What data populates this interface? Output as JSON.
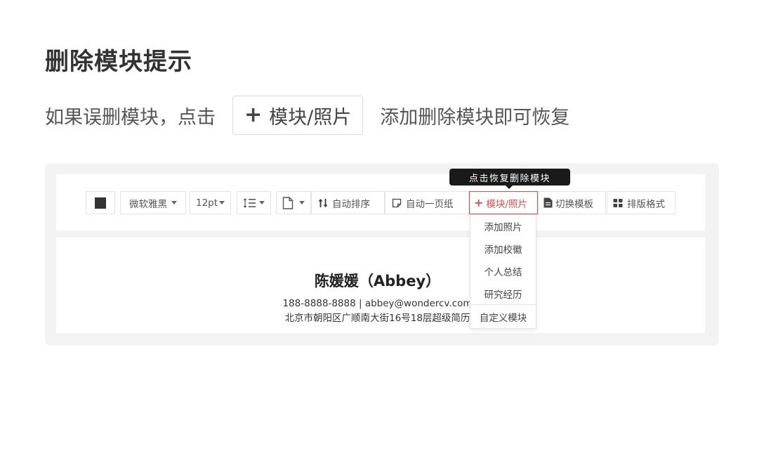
{
  "heading": "删除模块提示",
  "hint": {
    "before": "如果误删模块，点击",
    "button_plus": "+",
    "button_label": "模块/照片",
    "after": "添加删除模块即可恢复"
  },
  "toolbar": {
    "font": "微软雅黑",
    "font_size": "12pt",
    "sort_label": "自动排序",
    "onepage_label": "自动一页纸",
    "add_plus": "+",
    "add_label": "模块/照片",
    "template_label": "切换模板",
    "format_label": "排版格式"
  },
  "tooltip": "点击恢复删除模块",
  "dropdown": {
    "items": [
      "添加照片",
      "添加校徽",
      "个人总结",
      "研究经历",
      "自定义模块"
    ]
  },
  "resume": {
    "name": "陈媛媛（Abbey）",
    "contact": "188-8888-8888 | abbey@wondercv.com",
    "address": "北京市朝阳区广顺南大街16号18层超级简历"
  },
  "colors": {
    "accent": "#e94b4b",
    "stage_bg": "#f3f3f3",
    "tooltip_bg": "#1a1a1a"
  }
}
